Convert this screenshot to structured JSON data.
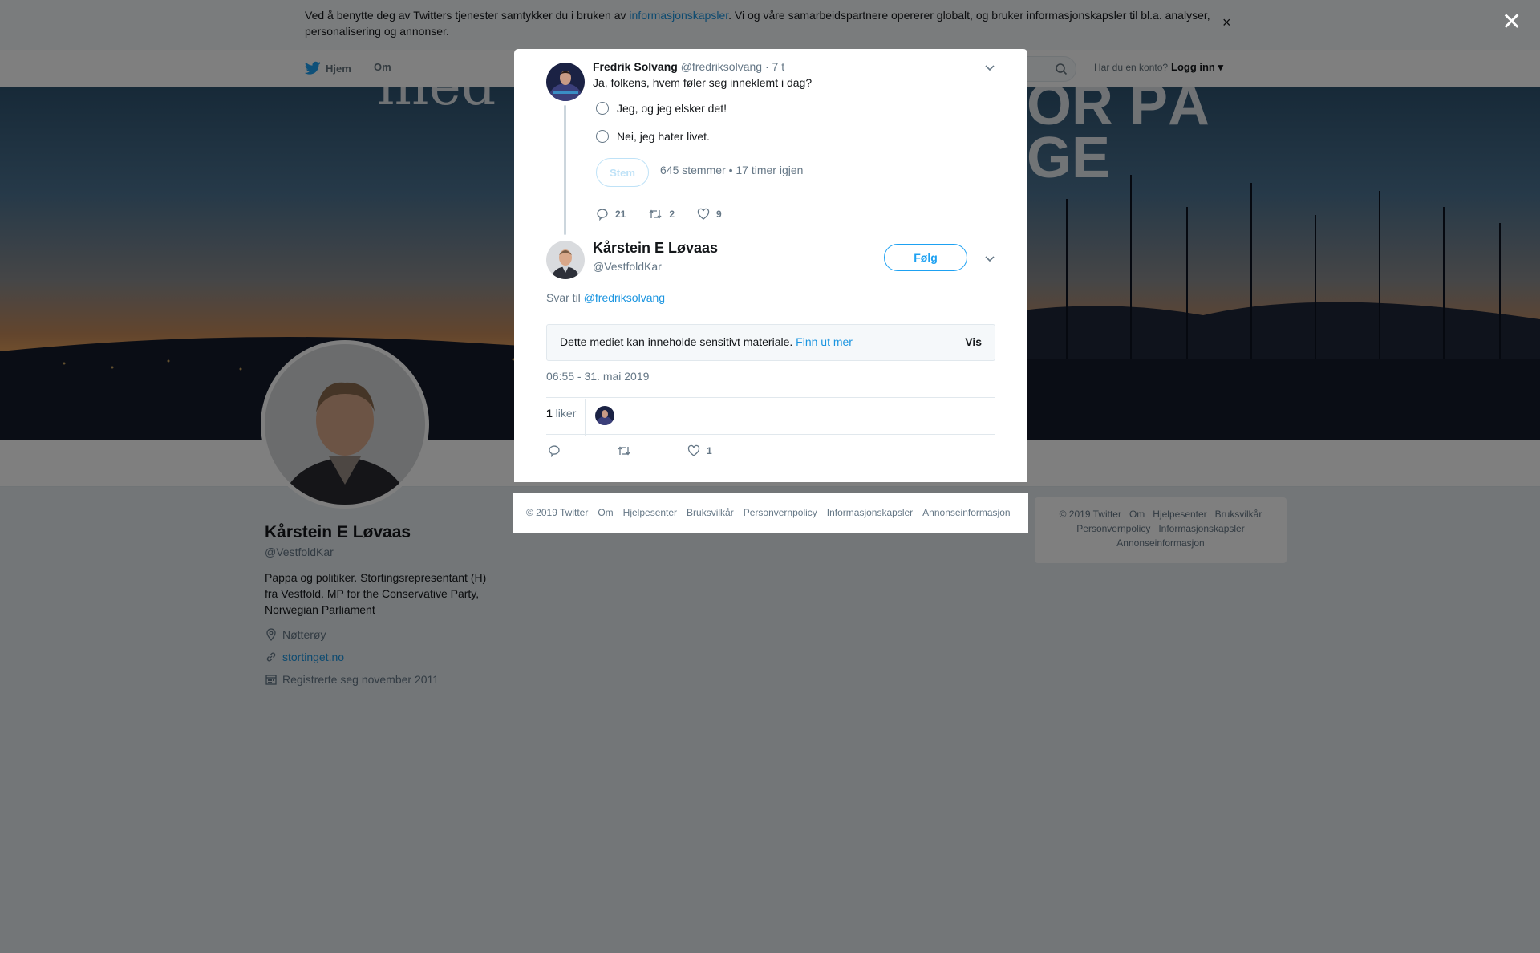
{
  "cookie": {
    "text_before": "Ved å benytte deg av Twitters tjenester samtykker du i bruken av ",
    "link": "informasjonskapsler",
    "text_after": ". Vi og våre samarbeidspartnere opererer globalt, og bruker informasjonskapsler til bl.a. analyser, personalisering og annonser.",
    "close": "×"
  },
  "nav": {
    "home": "Hjem",
    "about": "Om",
    "login_question": "Har du en konto?",
    "login": "Logg inn ▾"
  },
  "banner": {
    "text1": "med",
    "text2_line1": "OR PÅ",
    "text2_line2": "GE"
  },
  "profile": {
    "name": "Kårstein E Løvaas",
    "handle": "@VestfoldKar",
    "bio": "Pappa og politiker. Stortingsrepresentant (H) fra Vestfold. MP for the Conservative Party, Norwegian Parliament",
    "location": "Nøtterøy",
    "website": "stortinget.no",
    "joined": "Registrerte seg november 2011"
  },
  "right_footer": {
    "line1": [
      "© 2019 Twitter",
      "Om",
      "Hjelpesenter",
      "Bruksvilkår"
    ],
    "line2": [
      "Personvernpolicy",
      "Informasjonskapsler"
    ],
    "line3": [
      "Annonseinformasjon"
    ]
  },
  "modal": {
    "close": "✕",
    "parent_tweet": {
      "name": "Fredrik Solvang",
      "handle": "@fredriksolvang",
      "time": "· 7 t",
      "text": "Ja, folkens, hvem føler seg inneklemt i dag?",
      "poll_options": [
        "Jeg, og jeg elsker det!",
        "Nei, jeg hater livet."
      ],
      "vote_button": "Stem",
      "poll_meta": "645 stemmer • 17 timer igjen",
      "replies": "21",
      "retweets": "2",
      "likes": "9"
    },
    "main_tweet": {
      "name": "Kårstein E Løvaas",
      "handle": "@VestfoldKar",
      "follow": "Følg",
      "reply_to_label": "Svar til ",
      "reply_to_handle": "@fredriksolvang",
      "sensitive_text": "Dette mediet kan inneholde sensitivt materiale. ",
      "sensitive_link": "Finn ut mer",
      "sensitive_show": "Vis",
      "timestamp": "06:55 - 31. mai 2019",
      "like_count": "1",
      "like_label": " liker",
      "action_likes": "1"
    },
    "footer": [
      "© 2019 Twitter",
      "Om",
      "Hjelpesenter",
      "Bruksvilkår",
      "Personvernpolicy",
      "Informasjonskapsler",
      "Annonseinformasjon"
    ]
  }
}
